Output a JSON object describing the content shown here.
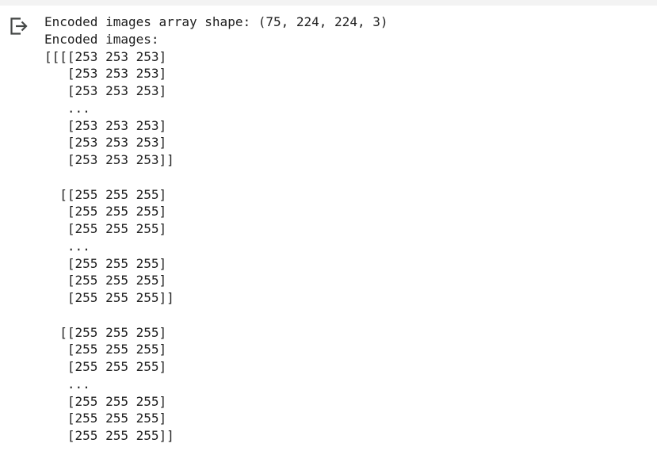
{
  "output": {
    "icon": "output-redirect-icon",
    "lines": [
      "Encoded images array shape: (75, 224, 224, 3)",
      "Encoded images:",
      "[[[[253 253 253]",
      "   [253 253 253]",
      "   [253 253 253]",
      "   ...",
      "   [253 253 253]",
      "   [253 253 253]",
      "   [253 253 253]]",
      "",
      "  [[255 255 255]",
      "   [255 255 255]",
      "   [255 255 255]",
      "   ...",
      "   [255 255 255]",
      "   [255 255 255]",
      "   [255 255 255]]",
      "",
      "  [[255 255 255]",
      "   [255 255 255]",
      "   [255 255 255]",
      "   ...",
      "   [255 255 255]",
      "   [255 255 255]",
      "   [255 255 255]]"
    ]
  },
  "colors": {
    "text": "#212121",
    "icon": "#444746",
    "top_strip": "#f3f3f3",
    "background": "#ffffff"
  }
}
